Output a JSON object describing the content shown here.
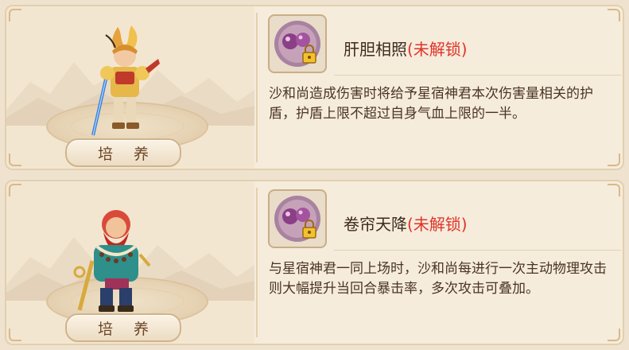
{
  "cards": [
    {
      "train_label": "培 养",
      "hero_icon": "golden-armored-general",
      "skill": {
        "icon": "purple-orb-lock-icon",
        "name": "肝胆相照",
        "status": "(未解锁)",
        "description": "沙和尚造成伤害时将给予星宿神君本次伤害量相关的护盾，护盾上限不超过自身气血上限的一半。"
      }
    },
    {
      "train_label": "培 养",
      "hero_icon": "red-bearded-monk-warrior",
      "skill": {
        "icon": "purple-orb-lock-icon",
        "name": "卷帘天降",
        "status": "(未解锁)",
        "description": "与星宿神君一同上场时，沙和尚每进行一次主动物理攻击则大幅提升当回合暴击率，多次攻击可叠加。"
      }
    }
  ],
  "colors": {
    "locked": "#e0332a",
    "text": "#3c2a1c",
    "card_bg": "#f6ecdc",
    "border": "#e2cfb0"
  }
}
